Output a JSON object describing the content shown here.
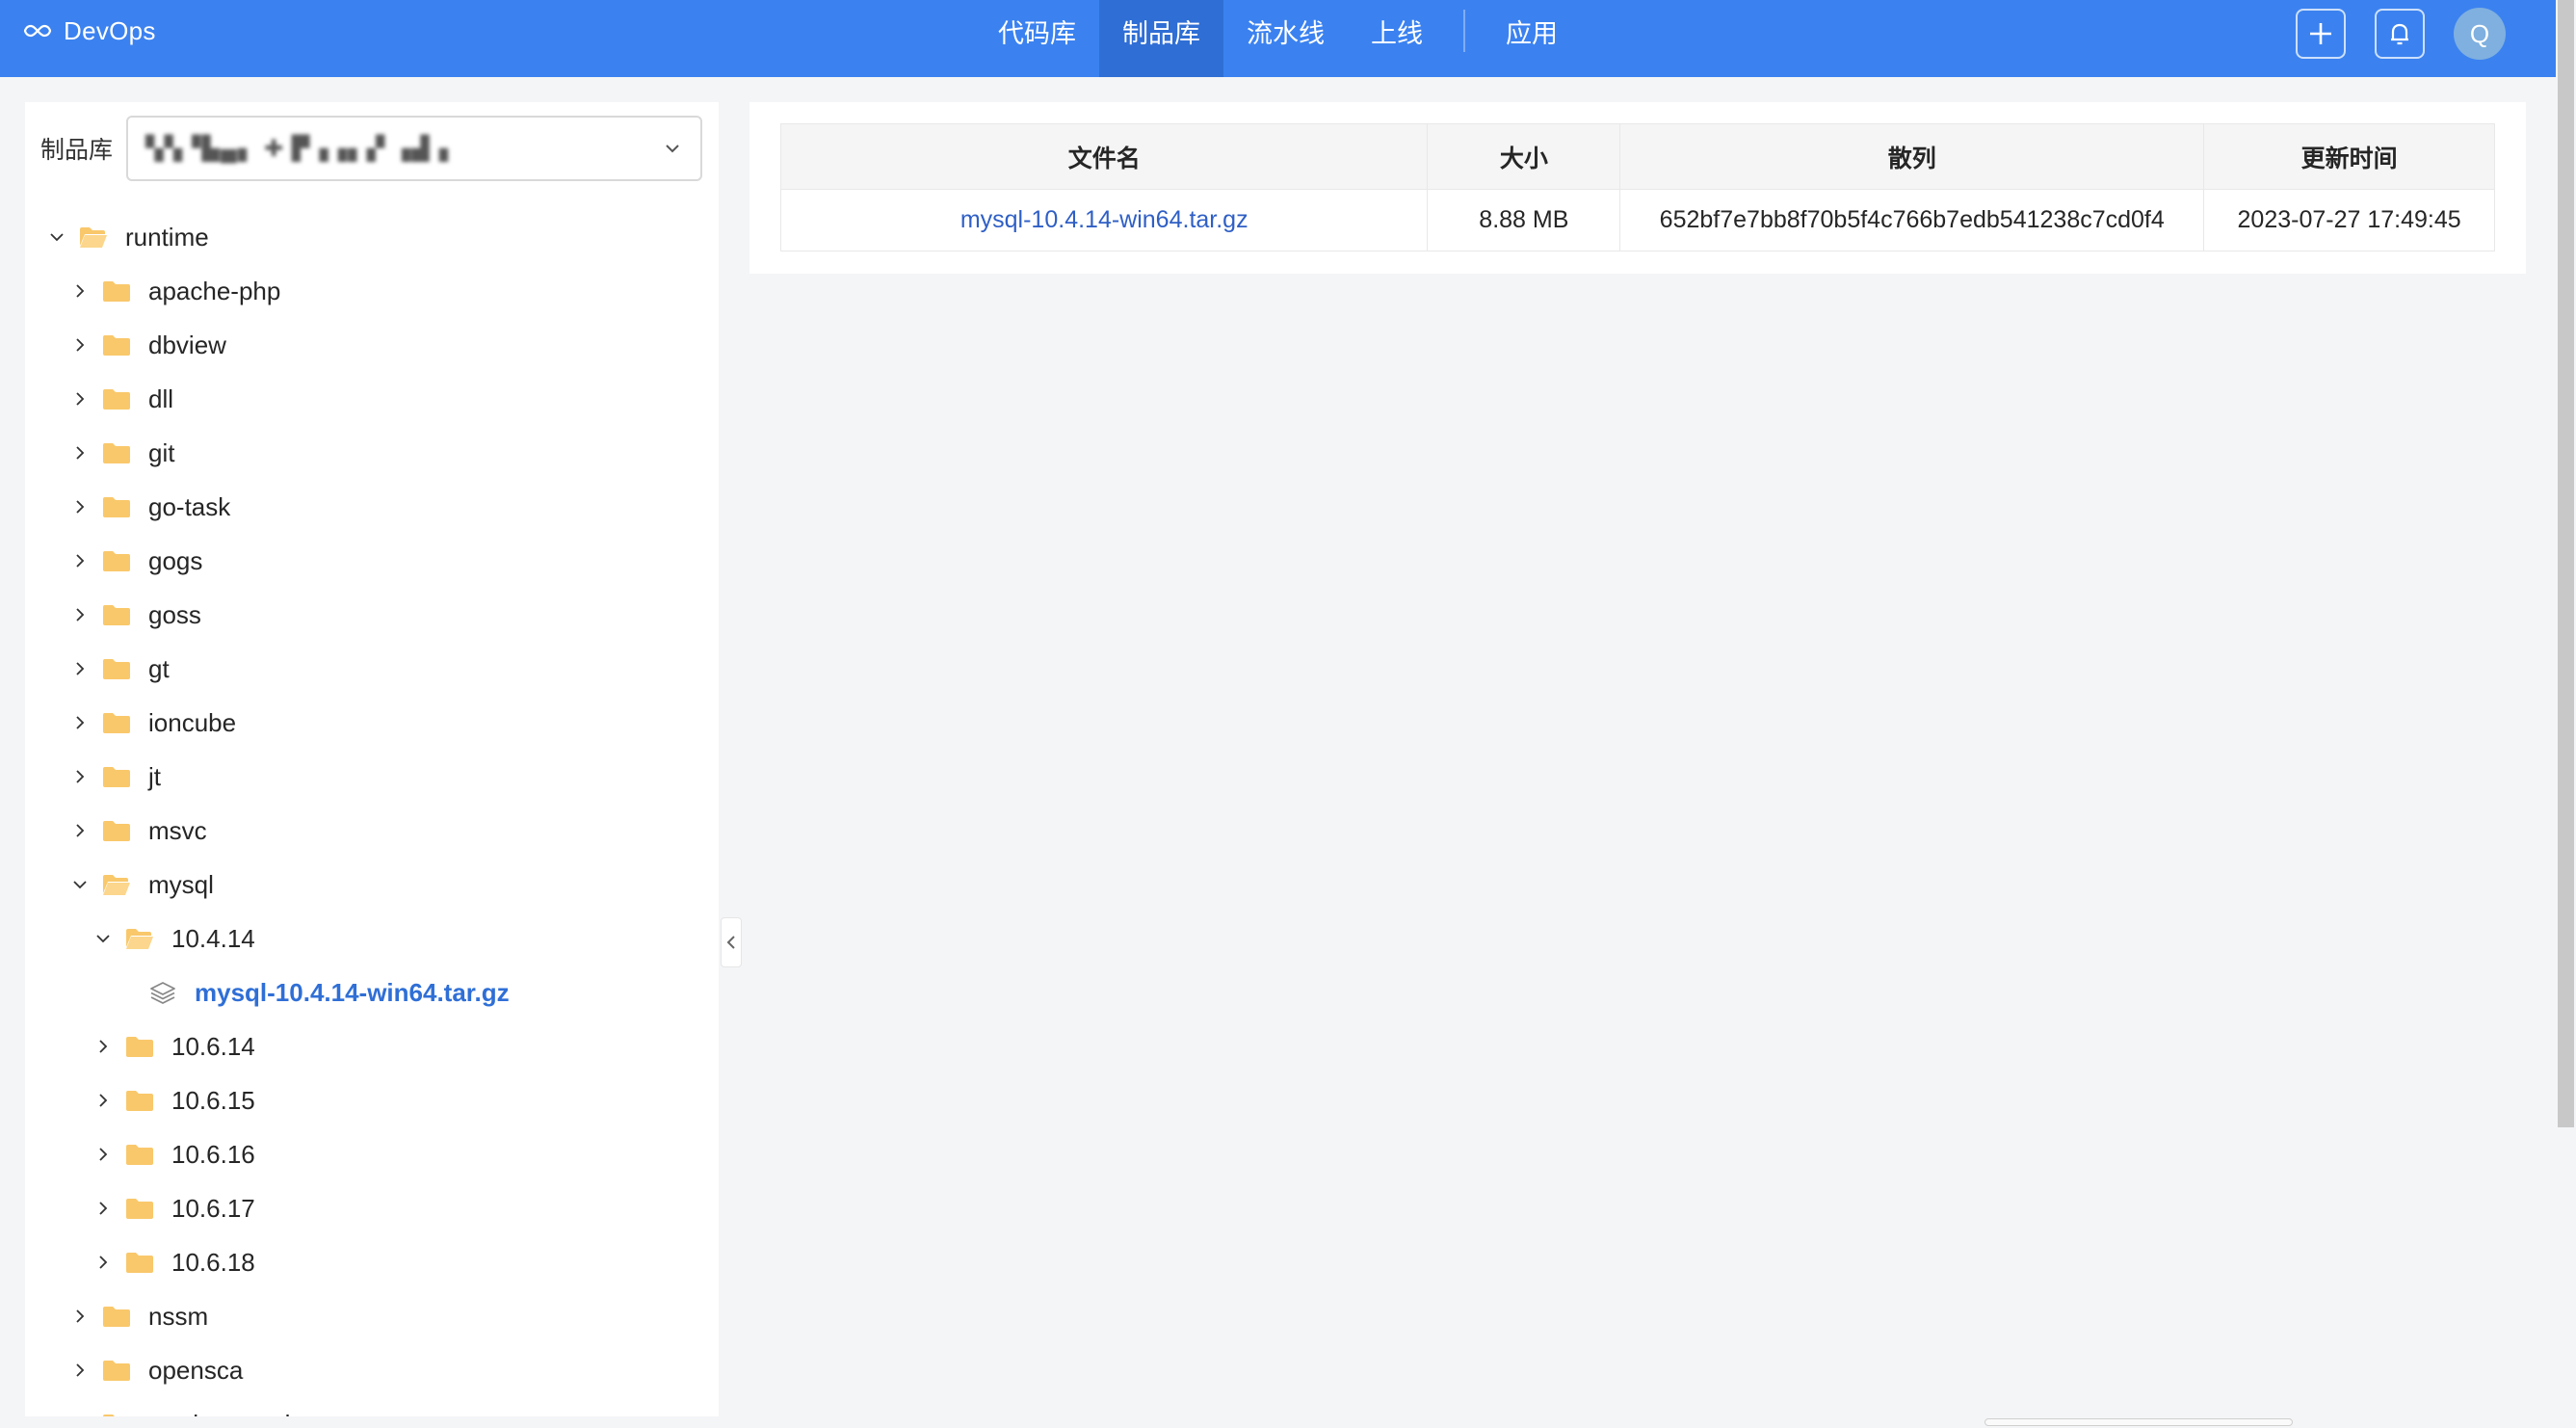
{
  "header": {
    "brand": "DevOps",
    "nav": [
      {
        "label": "代码库",
        "active": false
      },
      {
        "label": "制品库",
        "active": true
      },
      {
        "label": "流水线",
        "active": false
      },
      {
        "label": "上线",
        "active": false
      },
      {
        "label": "应用",
        "active": false
      }
    ],
    "avatar_letter": "Q",
    "colors": {
      "bar": "#3b82f0",
      "active_nav": "#2f6ed4"
    }
  },
  "sidebar": {
    "repo_label": "制品库",
    "repo_value": "▚▚▝▙▄▖ ✚ ▛▗▗▖▞ ▗▟▗",
    "tree": [
      {
        "label": "runtime",
        "depth": 0,
        "type": "folder",
        "expanded": true
      },
      {
        "label": "apache-php",
        "depth": 1,
        "type": "folder",
        "expanded": false
      },
      {
        "label": "dbview",
        "depth": 1,
        "type": "folder",
        "expanded": false
      },
      {
        "label": "dll",
        "depth": 1,
        "type": "folder",
        "expanded": false
      },
      {
        "label": "git",
        "depth": 1,
        "type": "folder",
        "expanded": false
      },
      {
        "label": "go-task",
        "depth": 1,
        "type": "folder",
        "expanded": false
      },
      {
        "label": "gogs",
        "depth": 1,
        "type": "folder",
        "expanded": false
      },
      {
        "label": "goss",
        "depth": 1,
        "type": "folder",
        "expanded": false
      },
      {
        "label": "gt",
        "depth": 1,
        "type": "folder",
        "expanded": false
      },
      {
        "label": "ioncube",
        "depth": 1,
        "type": "folder",
        "expanded": false
      },
      {
        "label": "jt",
        "depth": 1,
        "type": "folder",
        "expanded": false
      },
      {
        "label": "msvc",
        "depth": 1,
        "type": "folder",
        "expanded": false
      },
      {
        "label": "mysql",
        "depth": 1,
        "type": "folder",
        "expanded": true
      },
      {
        "label": "10.4.14",
        "depth": 2,
        "type": "folder",
        "expanded": true
      },
      {
        "label": "mysql-10.4.14-win64.tar.gz",
        "depth": 3,
        "type": "file",
        "selected": true
      },
      {
        "label": "10.6.14",
        "depth": 2,
        "type": "folder",
        "expanded": false
      },
      {
        "label": "10.6.15",
        "depth": 2,
        "type": "folder",
        "expanded": false
      },
      {
        "label": "10.6.16",
        "depth": 2,
        "type": "folder",
        "expanded": false
      },
      {
        "label": "10.6.17",
        "depth": 2,
        "type": "folder",
        "expanded": false
      },
      {
        "label": "10.6.18",
        "depth": 2,
        "type": "folder",
        "expanded": false
      },
      {
        "label": "nssm",
        "depth": 1,
        "type": "folder",
        "expanded": false
      },
      {
        "label": "opensca",
        "depth": 1,
        "type": "folder",
        "expanded": false
      },
      {
        "label": "render-template",
        "depth": 1,
        "type": "folder",
        "expanded": false
      }
    ]
  },
  "files_table": {
    "columns": [
      "文件名",
      "大小",
      "散列",
      "更新时间"
    ],
    "rows": [
      {
        "name": "mysql-10.4.14-win64.tar.gz",
        "size": "8.88 MB",
        "hash": "652bf7e7bb8f70b5f4c766b7edb541238c7cd0f4",
        "updated": "2023-07-27 17:49:45"
      }
    ]
  }
}
